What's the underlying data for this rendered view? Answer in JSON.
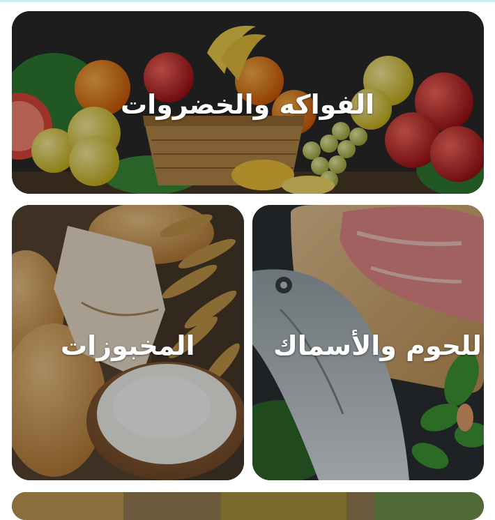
{
  "categories": [
    {
      "label": "الفواكه والخضروات",
      "image": "fruits-vegetables-photo"
    },
    {
      "label": "المخبوزات",
      "image": "bakery-photo"
    },
    {
      "label": "اللحوم والأسماك",
      "image": "meat-fish-photo"
    }
  ],
  "colors": {
    "overlay_text": "#ffffff",
    "top_accent": "#c9eef0"
  }
}
